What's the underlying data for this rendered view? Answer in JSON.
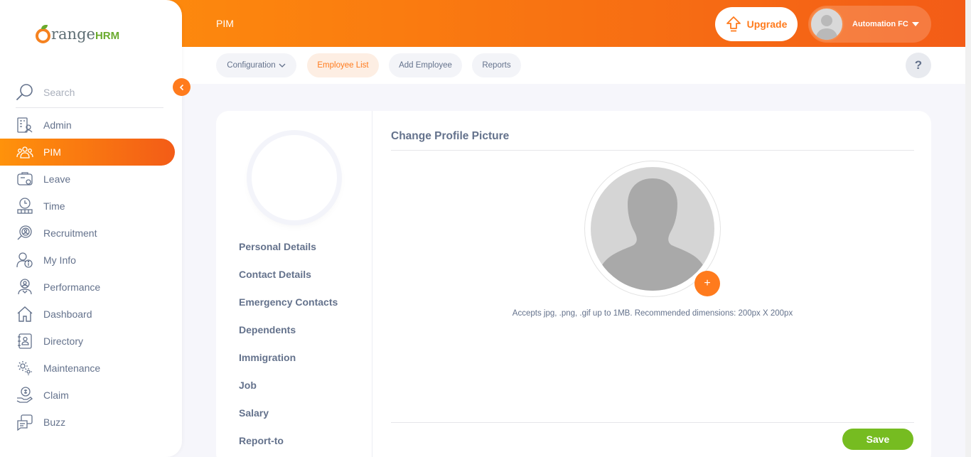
{
  "header": {
    "module_title": "PIM",
    "upgrade_label": "Upgrade",
    "user_name": "Automation FC"
  },
  "brand": {
    "logo_part1": "range",
    "logo_part2": "HRM"
  },
  "search": {
    "placeholder": "Search"
  },
  "sidebar": {
    "items": [
      {
        "label": "Admin",
        "icon": "admin-icon"
      },
      {
        "label": "PIM",
        "icon": "pim-icon",
        "active": true
      },
      {
        "label": "Leave",
        "icon": "leave-icon"
      },
      {
        "label": "Time",
        "icon": "time-icon"
      },
      {
        "label": "Recruitment",
        "icon": "recruitment-icon"
      },
      {
        "label": "My Info",
        "icon": "my-info-icon"
      },
      {
        "label": "Performance",
        "icon": "performance-icon"
      },
      {
        "label": "Dashboard",
        "icon": "dashboard-icon"
      },
      {
        "label": "Directory",
        "icon": "directory-icon"
      },
      {
        "label": "Maintenance",
        "icon": "maintenance-icon"
      },
      {
        "label": "Claim",
        "icon": "claim-icon"
      },
      {
        "label": "Buzz",
        "icon": "buzz-icon"
      }
    ]
  },
  "subnav": {
    "tabs": [
      {
        "label": "Configuration"
      },
      {
        "label": "Employee List",
        "active": true
      },
      {
        "label": "Add Employee"
      },
      {
        "label": "Reports"
      }
    ],
    "help_label": "?"
  },
  "employee_menu": {
    "items": [
      "Personal Details",
      "Contact Details",
      "Emergency Contacts",
      "Dependents",
      "Immigration",
      "Job",
      "Salary",
      "Report-to"
    ]
  },
  "profile_picture": {
    "title": "Change Profile Picture",
    "add_label": "+",
    "hint": "Accepts jpg, .png, .gif up to 1MB. Recommended dimensions: 200px X 200px",
    "save_label": "Save"
  },
  "colors": {
    "accent": "#ff7b1d",
    "gradient_start": "#ff920b",
    "gradient_end": "#f35c17",
    "save": "#76bc21"
  }
}
